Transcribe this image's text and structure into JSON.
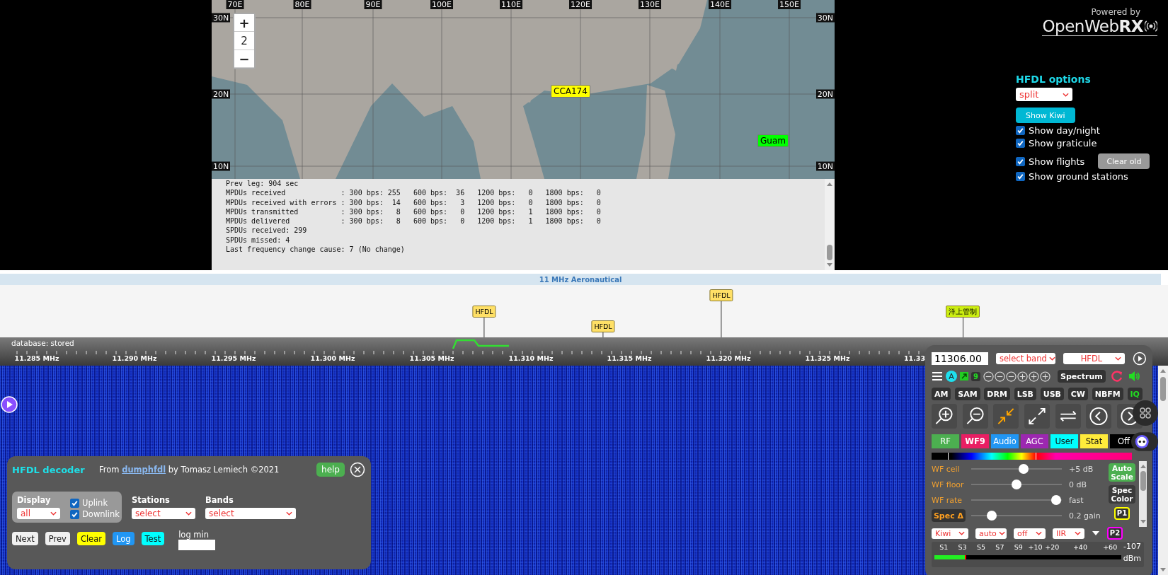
{
  "map": {
    "zoom_in": "+",
    "zoom_level": "2",
    "zoom_out": "−",
    "longitude_labels": [
      "70E",
      "80E",
      "90E",
      "100E",
      "110E",
      "120E",
      "130E",
      "140E",
      "150E"
    ],
    "latitude_labels_left": [
      "30N",
      "20N",
      "10N"
    ],
    "latitude_labels_right": [
      "30N",
      "20N",
      "10N"
    ],
    "markers": [
      {
        "label": "CCA174",
        "color": "#ffff00"
      },
      {
        "label": "Guam",
        "color": "#00ff00"
      }
    ]
  },
  "log": {
    "lines": [
      "Prev leg: 904 sec",
      "MPDUs received             : 300 bps: 255   600 bps:  36   1200 bps:   0   1800 bps:   0",
      "MPDUs received with errors : 300 bps:  14   600 bps:   3   1200 bps:   0   1800 bps:   0",
      "MPDUs transmitted          : 300 bps:   8   600 bps:   0   1200 bps:   1   1800 bps:   0",
      "MPDUs delivered            : 300 bps:   8   600 bps:   0   1200 bps:   1   1800 bps:   0",
      "SPDUs received: 299",
      "SPDUs missed: 4",
      "Last frequency change cause: 7 (No change)"
    ]
  },
  "branding": {
    "tagline": "Powered by",
    "name": "OpenWeb**RX**"
  },
  "hfdl_options": {
    "title": "HFDL options",
    "view_select": "split",
    "show_kiwi_button": "Show Kiwi",
    "clear_old_button": "Clear old",
    "checkboxes": [
      {
        "label": "Show day/night",
        "checked": true
      },
      {
        "label": "Show graticule",
        "checked": true
      },
      {
        "label": "Show flights",
        "checked": true
      },
      {
        "label": "Show ground stations",
        "checked": true
      }
    ]
  },
  "band_bar": {
    "title": "11 MHz Aeronautical"
  },
  "bookmarks": [
    {
      "label": "HFDL",
      "color": "#ffe066"
    },
    {
      "label": "HFDL",
      "color": "#ffe066"
    },
    {
      "label": "HFDL",
      "color": "#ffe066"
    },
    {
      "label": "洋上管制",
      "color": "#ccee11"
    }
  ],
  "scale": {
    "status": "database: stored",
    "ticks": [
      "11.285 MHz",
      "11.290 MHz",
      "11.295 MHz",
      "11.300 MHz",
      "11.305 MHz",
      "11.310 MHz",
      "11.315 MHz",
      "11.320 MHz",
      "11.325 MHz",
      "11.33"
    ]
  },
  "decoder": {
    "title": "HFDL decoder",
    "credit_prefix": "From",
    "credit_link": "dumphfdl",
    "credit_suffix": "by Tomasz Lemiech ©2021",
    "help_button": "help",
    "display": {
      "label": "Display",
      "select": "all",
      "checkboxes": [
        {
          "label": "Uplink",
          "checked": true
        },
        {
          "label": "Downlink",
          "checked": true
        }
      ]
    },
    "stations": {
      "label": "Stations",
      "select": "select"
    },
    "bands": {
      "label": "Bands",
      "select": "select"
    },
    "buttons": [
      {
        "label": "Next",
        "color": "#f0f0f0"
      },
      {
        "label": "Prev",
        "color": "#f0f0f0"
      },
      {
        "label": "Clear",
        "color": "#ffff00"
      },
      {
        "label": "Log",
        "color": "#2196f3"
      },
      {
        "label": "Test",
        "color": "#00ffff"
      }
    ],
    "log_min_label": "log min"
  },
  "receiver": {
    "frequency": "11306.00",
    "band_select": "select band",
    "mode_select": "HFDL",
    "agc_badge": "A",
    "count_badge": "9",
    "spectrum_button": "Spectrum",
    "modes": [
      {
        "label": "AM",
        "selected": false
      },
      {
        "label": "SAM",
        "selected": false
      },
      {
        "label": "DRM",
        "selected": false
      },
      {
        "label": "LSB",
        "selected": false
      },
      {
        "label": "USB",
        "selected": false
      },
      {
        "label": "CW",
        "selected": false
      },
      {
        "label": "NBFM",
        "selected": false
      },
      {
        "label": "IQ",
        "selected": true
      }
    ],
    "tabs": [
      {
        "label": "RF",
        "color": "#4caf50",
        "selected": false
      },
      {
        "label": "WF9",
        "color": "#e91e63",
        "selected": true
      },
      {
        "label": "Audio",
        "color": "#2196f3",
        "selected": false
      },
      {
        "label": "AGC",
        "color": "#9c27b0",
        "selected": false
      },
      {
        "label": "User",
        "color": "#00ffff",
        "selected": false
      },
      {
        "label": "Stat",
        "color": "#ffeb3b",
        "selected": false
      },
      {
        "label": "Off",
        "color": "#000000",
        "selected": false
      }
    ],
    "sliders": [
      {
        "kind": "label",
        "label": "WF ceil",
        "level": 0.58,
        "reading": "+5 dB"
      },
      {
        "kind": "label",
        "label": "WF floor",
        "level": 0.5,
        "reading": "0 dB"
      },
      {
        "kind": "label",
        "label": "WF rate",
        "level": 0.94,
        "reading": "fast"
      },
      {
        "kind": "button",
        "label": "Spec Δ",
        "level": 0.23,
        "reading": "0.2 gain"
      }
    ],
    "side_buttons": [
      {
        "kind": "filled",
        "label": "Auto Scale",
        "color": "#4caf50"
      },
      {
        "kind": "dark",
        "label": "Spec Color"
      },
      {
        "kind": "outlined",
        "label": "P1",
        "color": "#ffff00"
      }
    ],
    "selects": [
      "Kiwi",
      "auto",
      "off",
      "IIR"
    ],
    "preset_button": {
      "label": "P2",
      "color": "#ff00ff"
    },
    "smeter": {
      "labels": [
        "S1",
        "S3",
        "S5",
        "S7",
        "S9",
        "+10",
        "+20",
        "+40",
        "+60"
      ],
      "reading": "-107",
      "unit": "dBm",
      "level": 0.17
    }
  }
}
